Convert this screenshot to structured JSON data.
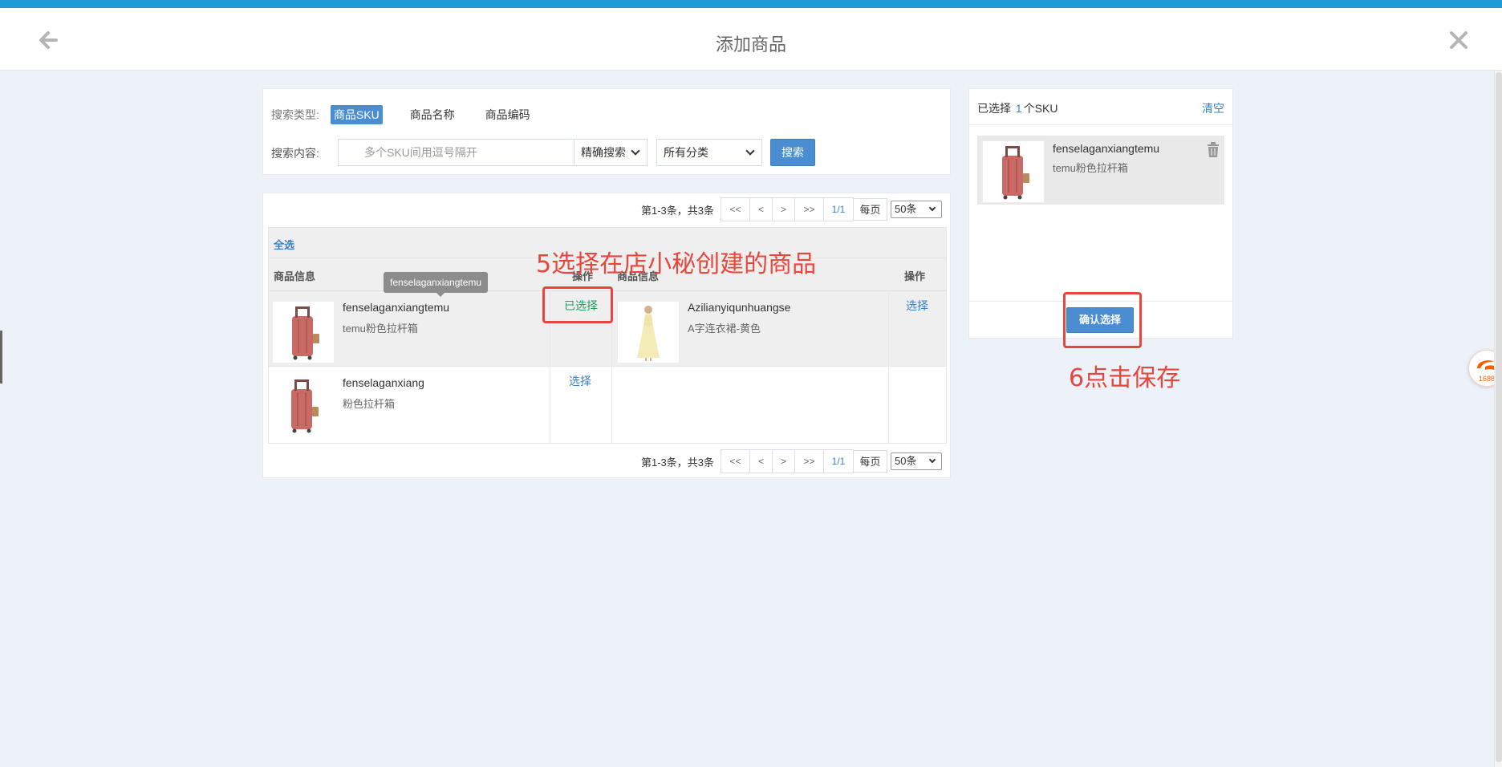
{
  "header": {
    "title": "添加商品"
  },
  "search": {
    "type_label": "搜索类型:",
    "types": [
      "商品SKU",
      "商品名称",
      "商品编码"
    ],
    "content_label": "搜索内容:",
    "placeholder": "多个SKU间用逗号隔开",
    "match_mode": "精确搜索",
    "category": "所有分类",
    "search_button": "搜索"
  },
  "pagination": {
    "info": "第1-3条，共3条",
    "first": "<<",
    "prev": "<",
    "next": ">",
    "last": ">>",
    "page": "1/1",
    "per_page_label": "每页",
    "per_page": "50条"
  },
  "table": {
    "select_all": "全选",
    "col_info": "商品信息",
    "col_action": "操作",
    "products": [
      {
        "name": "fenselaganxiangtemu",
        "desc": "temu粉色拉杆箱",
        "action": "已选择"
      },
      {
        "name": "Azilianyiqunhuangse",
        "desc": "A字连衣裙-黄色",
        "action": "选择"
      },
      {
        "name": "fenselaganxiang",
        "desc": "粉色拉杆箱",
        "action": "选择"
      }
    ],
    "tooltip": "fenselaganxiangtemu"
  },
  "selected_panel": {
    "prefix": "已选择",
    "count": "1",
    "suffix": "个SKU",
    "clear": "清空",
    "item": {
      "name": "fenselaganxiangtemu",
      "desc": "temu粉色拉杆箱"
    },
    "confirm_button": "确认选择"
  },
  "annotations": {
    "step5": "5选择在店小秘创建的商品",
    "step6": "6点击保存"
  },
  "badge": {
    "text": "1688"
  },
  "colors": {
    "accent": "#4a8ed1",
    "link": "#3b7fc4",
    "selected": "#19a15f",
    "annotation": "#e8453c",
    "topbar": "#1f9bd7"
  }
}
